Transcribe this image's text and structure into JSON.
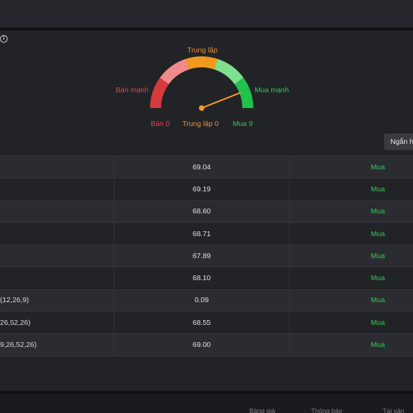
{
  "gauge": {
    "label_neutral": "Trung lập",
    "label_strong_sell": "Bán mạnh",
    "label_strong_buy": "Mua mạnh",
    "count_sell": "Bán 0",
    "count_neutral": "Trung lập 0",
    "count_buy": "Mua 9",
    "needle_value": 0.88,
    "colors": {
      "strong_sell": "#d63a3a",
      "sell": "#f08a8a",
      "neutral": "#f39a1e",
      "buy": "#7fe08f",
      "strong_buy": "#1fc24a",
      "needle": "#f39a1e"
    }
  },
  "timeframe_button": "Ngắn h",
  "table": {
    "rows": [
      {
        "name": "",
        "value": "69.04",
        "action": "Mua"
      },
      {
        "name": "",
        "value": "69.19",
        "action": "Mua"
      },
      {
        "name": "",
        "value": "68.60",
        "action": "Mua"
      },
      {
        "name": "",
        "value": "68.71",
        "action": "Mua"
      },
      {
        "name": "",
        "value": "67.89",
        "action": "Mua"
      },
      {
        "name": "",
        "value": "68.10",
        "action": "Mua"
      },
      {
        "name": "(12,26,9)",
        "value": "0.09",
        "action": "Mua"
      },
      {
        "name": "26,52,26)",
        "value": "68.55",
        "action": "Mua"
      },
      {
        "name": "9,26,52,26)",
        "value": "69.00",
        "action": "Mua"
      }
    ]
  },
  "statusbar": {
    "item_1": "Bảng giá",
    "item_2": "Thông báo",
    "item_3": "Tài sản"
  }
}
